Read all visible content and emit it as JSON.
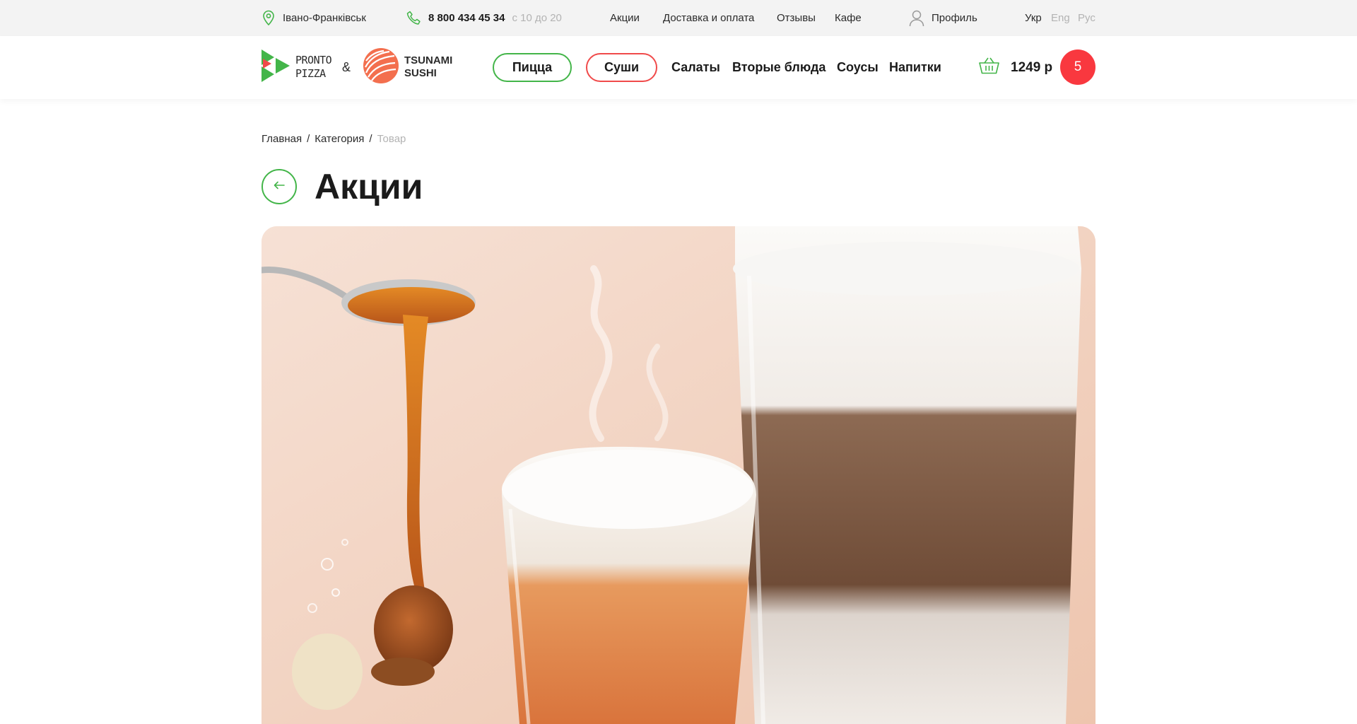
{
  "topbar": {
    "city": "Івано-Франківськ",
    "phone": "8 800 434 45 34",
    "hours": "с 10 до 20",
    "links": [
      "Акции",
      "Доставка и оплата",
      "Отзывы",
      "Кафе"
    ],
    "profile": "Профиль",
    "languages": [
      "Укр",
      "Eng",
      "Рус"
    ]
  },
  "header": {
    "logo1": {
      "line1": "PRONTO",
      "line2": "PIZZA"
    },
    "ampersand": "&",
    "logo2": {
      "line1": "TSUNAMI",
      "line2": "SUSHI"
    },
    "nav": [
      "Пицца",
      "Суши",
      "Салаты",
      "Вторые блюда",
      "Соусы",
      "Напитки"
    ],
    "cart_total": "1249 р",
    "cart_count": "5"
  },
  "breadcrumb": [
    "Главная",
    "Категория",
    "Товар"
  ],
  "page_title": "Акции",
  "colors": {
    "green": "#43b549",
    "red": "#f04a4a",
    "orange": "#f36f4e",
    "cart_badge": "#f9383f"
  }
}
